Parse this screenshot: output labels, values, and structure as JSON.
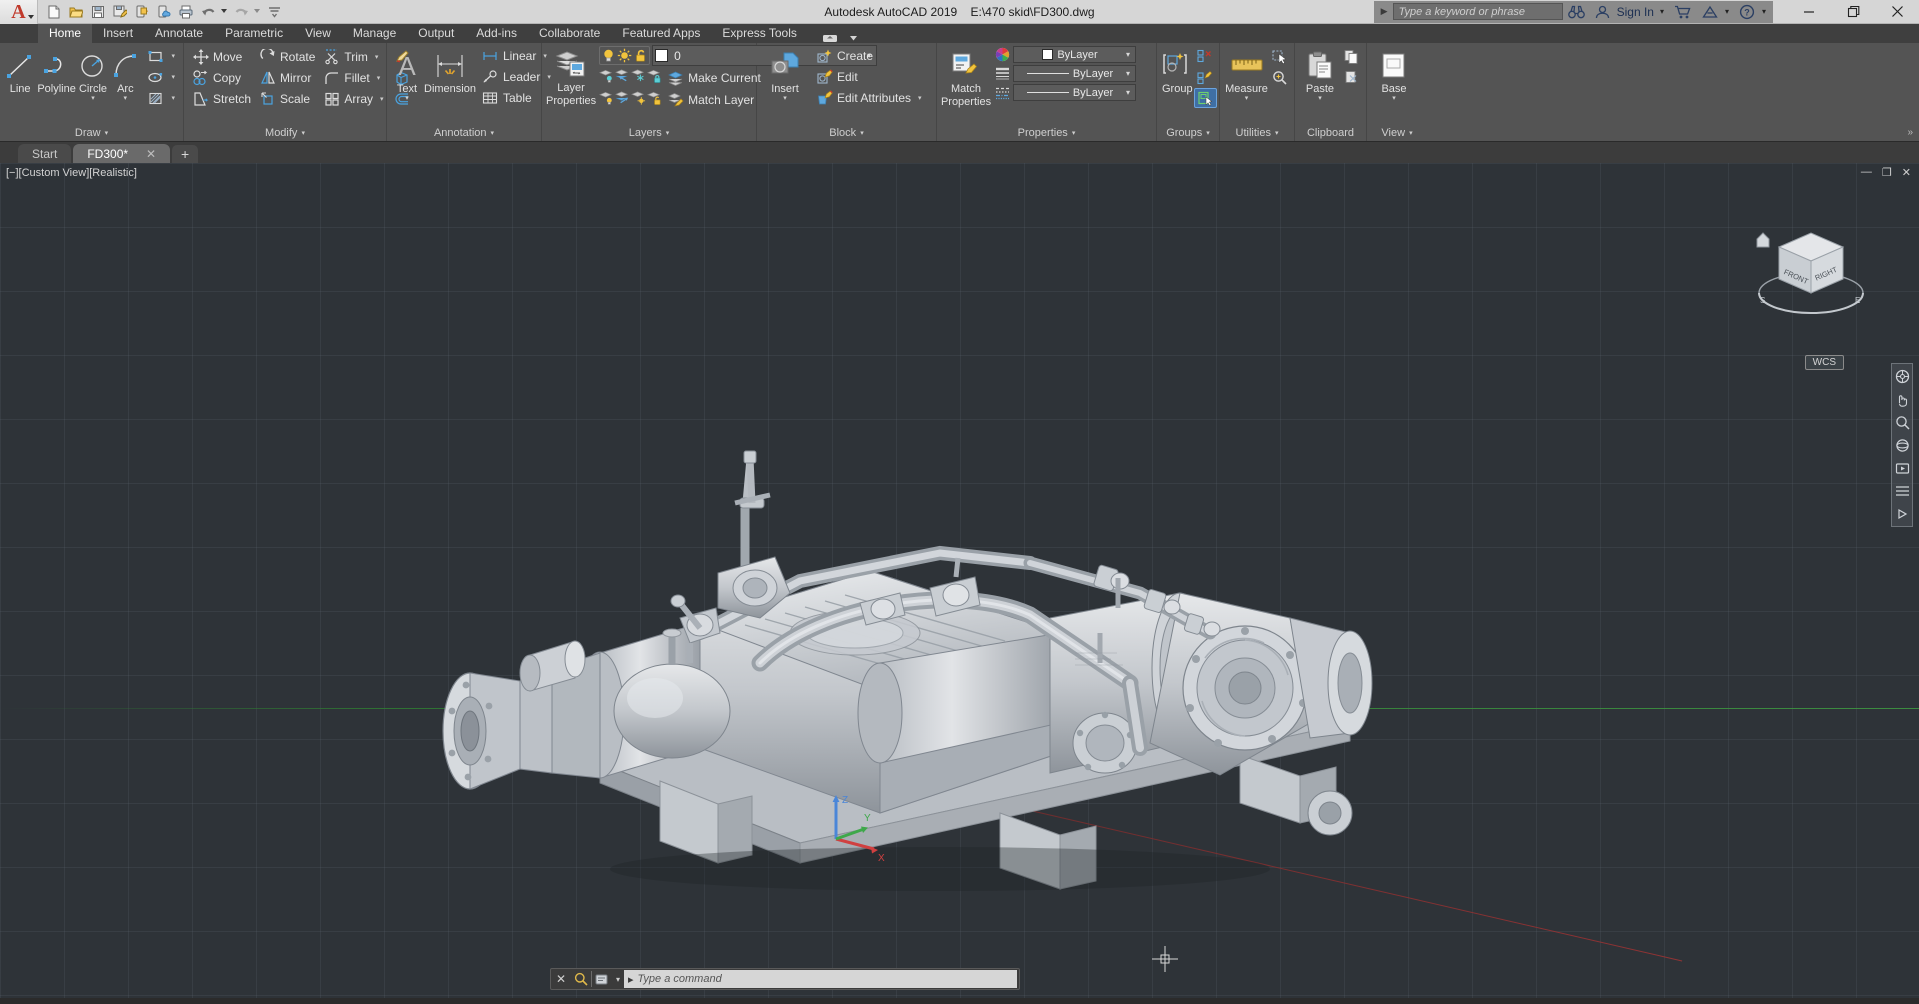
{
  "window": {
    "title": "Autodesk AutoCAD 2019    E:\\470 skid\\FD300.dwg",
    "app_letter": "A",
    "minimize": "—",
    "maximize": "❐",
    "close": "✕"
  },
  "quick_access": [
    {
      "name": "new-icon",
      "label": "New"
    },
    {
      "name": "open-icon",
      "label": "Open"
    },
    {
      "name": "save-icon",
      "label": "Save"
    },
    {
      "name": "save-as-icon",
      "label": "Save As"
    },
    {
      "name": "export-icon",
      "label": "Export"
    },
    {
      "name": "cloud-icon",
      "label": "Save to Web & Mobile"
    },
    {
      "name": "plot-icon",
      "label": "Plot"
    },
    {
      "name": "undo-icon",
      "label": "Undo"
    },
    {
      "name": "redo-icon",
      "label": "Redo"
    },
    {
      "name": "customize-qat-icon",
      "label": "Customize"
    }
  ],
  "infocenter": {
    "expand_arrow": "▶",
    "search_placeholder": "Type a keyword or phrase",
    "search_value": "",
    "binoculars_icon": "search-binoculars-icon",
    "signin_label": "Sign In",
    "caret": "▾",
    "cart_icon": "shopping-cart-icon",
    "autodesk_icon": "autodesk-app-icon",
    "help_label": "?"
  },
  "tabs": [
    {
      "label": "Home",
      "active": true
    },
    {
      "label": "Insert",
      "active": false
    },
    {
      "label": "Annotate",
      "active": false
    },
    {
      "label": "Parametric",
      "active": false
    },
    {
      "label": "View",
      "active": false
    },
    {
      "label": "Manage",
      "active": false
    },
    {
      "label": "Output",
      "active": false
    },
    {
      "label": "Add-ins",
      "active": false
    },
    {
      "label": "Collaborate",
      "active": false
    },
    {
      "label": "Featured Apps",
      "active": false
    },
    {
      "label": "Express Tools",
      "active": false
    }
  ],
  "panels": {
    "draw": {
      "title": "Draw",
      "caret": "▾",
      "big": [
        {
          "label": "Line",
          "icon": "line-icon",
          "caret": ""
        },
        {
          "label": "Polyline",
          "icon": "polyline-icon",
          "caret": ""
        },
        {
          "label": "Circle",
          "icon": "circle-icon",
          "caret": "▾"
        },
        {
          "label": "Arc",
          "icon": "arc-icon",
          "caret": "▾"
        }
      ],
      "small": [
        {
          "icon": "rectangle-icon",
          "caret": "▾"
        },
        {
          "icon": "ellipse-icon",
          "caret": "▾"
        },
        {
          "icon": "hatch-icon",
          "caret": "▾"
        }
      ]
    },
    "modify": {
      "title": "Modify",
      "caret": "▾",
      "items": [
        {
          "label": "Move",
          "icon": "move-icon"
        },
        {
          "label": "Rotate",
          "icon": "rotate-icon"
        },
        {
          "label": "Trim",
          "icon": "trim-icon",
          "caret": "▾"
        },
        {
          "label": "Copy",
          "icon": "copy-icon"
        },
        {
          "label": "Mirror",
          "icon": "mirror-icon"
        },
        {
          "label": "Fillet",
          "icon": "fillet-icon",
          "caret": "▾"
        },
        {
          "label": "Stretch",
          "icon": "stretch-icon"
        },
        {
          "label": "Scale",
          "icon": "scale-icon"
        },
        {
          "label": "Array",
          "icon": "array-icon",
          "caret": "▾"
        }
      ],
      "extras": [
        {
          "icon": "erase-icon"
        },
        {
          "icon": "3d-solid-icon"
        },
        {
          "icon": "offset-icon"
        }
      ]
    },
    "annotation": {
      "title": "Annotation",
      "caret": "▾",
      "big": [
        {
          "label": "Text",
          "icon": "text-icon",
          "caret": "▾"
        },
        {
          "label": "Dimension",
          "icon": "dimension-icon",
          "caret": ""
        }
      ],
      "small": [
        {
          "label": "Linear",
          "icon": "linear-dim-icon",
          "caret": "▾"
        },
        {
          "label": "Leader",
          "icon": "leader-icon",
          "caret": "▾"
        },
        {
          "label": "Table",
          "icon": "table-icon",
          "caret": ""
        }
      ]
    },
    "layers": {
      "title": "Layers",
      "caret": "▾",
      "big": {
        "label_line1": "Layer",
        "label_line2": "Properties",
        "icon": "layer-properties-icon"
      },
      "current_layer": "0",
      "layer_caret": "▾",
      "state_icons": [
        "layer-on-bulb-icon",
        "layer-freeze-sun-icon",
        "layer-unlock-icon"
      ],
      "tools_row1": [
        "layer-isolate-icon",
        "layer-unisolate-icon",
        "layer-freeze-icon",
        "layer-lock-icon"
      ],
      "tools_row2": [
        "layer-off-icon",
        "layer-turn-all-on-icon",
        "layer-thaw-all-icon",
        "layer-unlock-object-icon"
      ],
      "make_current": "Make Current",
      "make_current_icon": "make-current-icon",
      "match_layer": "Match Layer",
      "match_layer_icon": "match-layer-icon"
    },
    "block": {
      "title": "Block",
      "caret": "▾",
      "big": {
        "label": "Insert",
        "icon": "insert-block-icon",
        "caret": "▾"
      },
      "items": [
        {
          "label": "Create",
          "icon": "create-block-icon",
          "caret": ""
        },
        {
          "label": "Edit",
          "icon": "edit-block-icon",
          "caret": ""
        },
        {
          "label": "Edit Attributes",
          "icon": "edit-attributes-icon",
          "caret": "▾"
        }
      ]
    },
    "properties": {
      "title": "Properties",
      "caret": "▾",
      "big": {
        "label_line1": "Match",
        "label_line2": "Properties",
        "icon": "match-properties-icon"
      },
      "color_icon": "color-wheel-icon",
      "lineweight_icon": "lineweight-icon",
      "linetype_icon": "linetype-icon",
      "color_value": "ByLayer",
      "lineweight_value": "ByLayer",
      "linetype_value": "ByLayer",
      "caret_small": "▾"
    },
    "groups": {
      "title": "Groups",
      "caret": "▾",
      "big": {
        "label": "Group",
        "icon": "group-icon"
      },
      "small": [
        {
          "icon": "ungroup-icon"
        },
        {
          "icon": "group-edit-icon"
        },
        {
          "icon": "group-selection-on-icon"
        }
      ]
    },
    "utilities": {
      "title": "Utilities",
      "caret": "▾",
      "big": {
        "label": "Measure",
        "icon": "measure-icon",
        "caret": "▾"
      },
      "small": [
        {
          "icon": "quick-select-icon"
        },
        {
          "icon": "quick-calc-icon"
        }
      ]
    },
    "clipboard": {
      "title": "Clipboard",
      "caret": "",
      "big": {
        "label": "Paste",
        "icon": "paste-icon",
        "caret": "▾"
      },
      "small": [
        {
          "icon": "copy-clip-icon"
        },
        {
          "icon": "cut-clip-icon"
        }
      ]
    },
    "view": {
      "title": "View",
      "caret": "▾",
      "big": {
        "label": "Base",
        "icon": "base-view-icon",
        "caret": "▾"
      }
    }
  },
  "drawing_tabs": [
    {
      "label": "Start",
      "active": false,
      "closable": false
    },
    {
      "label": "FD300*",
      "active": true,
      "closable": true,
      "close": "✕"
    }
  ],
  "drawing_tab_add": "+",
  "viewport": {
    "label": "[−][Custom View][Realistic]",
    "controls": [
      {
        "name": "viewport-minimize",
        "glyph": "—"
      },
      {
        "name": "viewport-restore",
        "glyph": "❐"
      },
      {
        "name": "viewport-close",
        "glyph": "✕"
      }
    ],
    "wcs_badge": "WCS",
    "viewcube": {
      "front": "FRONT",
      "right": "RIGHT",
      "compass_s": "S",
      "compass_e": "E"
    },
    "ucs": {
      "x": "X",
      "y": "Y",
      "z": "Z"
    },
    "background_color": "#2e3338",
    "model_color": "#c9ccd1"
  },
  "command_line": {
    "close_glyph": "✕",
    "search_icon": "cmd-search-icon",
    "history_icon": "cmd-history-icon",
    "history_caret": "▾",
    "prompt": "▸",
    "placeholder": "Type a command",
    "value": ""
  }
}
